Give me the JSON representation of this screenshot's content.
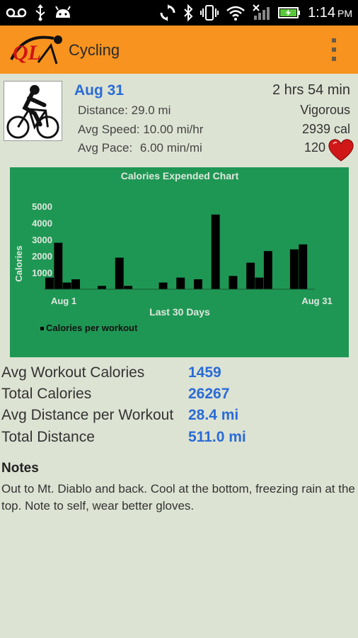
{
  "status_bar": {
    "time": "1:14",
    "ampm": "PM",
    "icons": [
      "voicemail-icon",
      "usb-icon",
      "android-icon",
      "sync-icon",
      "bluetooth-icon",
      "vibrate-icon",
      "wifi-icon",
      "signal-icon",
      "battery-icon"
    ]
  },
  "app_bar": {
    "title": "Cycling",
    "logo_text": "QL",
    "menu_icon": "overflow-menu-icon"
  },
  "workout": {
    "date": "Aug 31",
    "duration": "2 hrs 54 min",
    "distance_label": "Distance:",
    "distance_value": "29.0 mi",
    "speed_label": "Avg Speed:",
    "speed_value": "10.00 mi/hr",
    "pace_label": "Avg Pace:",
    "pace_value": "6.00 min/mi",
    "intensity": "Vigorous",
    "calories": "2939 cal",
    "heart_rate": "120",
    "heart_icon": "heart-icon",
    "image_icon": "cyclist-icon"
  },
  "chart_data": {
    "type": "bar",
    "title": "Calories Expended Chart",
    "xlabel": "Last 30 Days",
    "ylabel": "Calories",
    "x_start_label": "Aug 1",
    "x_end_label": "Aug 31",
    "yticks": [
      1000,
      2000,
      3000,
      4000,
      5000
    ],
    "ylim": [
      0,
      5000
    ],
    "legend": "Calories per workout",
    "legend_position": "bottom-left",
    "days": 31,
    "bars": [
      {
        "day": 1,
        "value": 700
      },
      {
        "day": 2,
        "value": 2800
      },
      {
        "day": 3,
        "value": 400
      },
      {
        "day": 4,
        "value": 600
      },
      {
        "day": 7,
        "value": 200
      },
      {
        "day": 9,
        "value": 1900
      },
      {
        "day": 10,
        "value": 200
      },
      {
        "day": 14,
        "value": 400
      },
      {
        "day": 16,
        "value": 700
      },
      {
        "day": 18,
        "value": 600
      },
      {
        "day": 20,
        "value": 4500
      },
      {
        "day": 22,
        "value": 800
      },
      {
        "day": 24,
        "value": 1600
      },
      {
        "day": 25,
        "value": 700
      },
      {
        "day": 26,
        "value": 2300
      },
      {
        "day": 29,
        "value": 2400
      },
      {
        "day": 30,
        "value": 2700
      }
    ]
  },
  "totals": {
    "avg_workout_calories_label": "Avg Workout Calories",
    "avg_workout_calories_value": "1459",
    "total_calories_label": "Total Calories",
    "total_calories_value": "26267",
    "avg_distance_label": "Avg Distance per Workout",
    "avg_distance_value": "28.4 mi",
    "total_distance_label": "Total Distance",
    "total_distance_value": "511.0 mi"
  },
  "notes": {
    "title": "Notes",
    "text": "Out to Mt. Diablo and back.  Cool at the bottom, freezing rain at the top.  Note to self, wear better gloves."
  },
  "colors": {
    "action_bar": "#f7931e",
    "background": "#dde3d3",
    "chart_bg": "#1f9754",
    "accent_blue": "#2a6bd6",
    "heart_red": "#d01818"
  }
}
